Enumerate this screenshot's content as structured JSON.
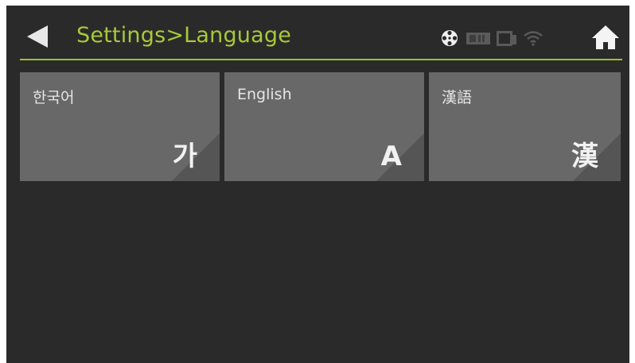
{
  "header": {
    "title": "Settings>Language",
    "back_icon": "back-arrow-icon",
    "home_icon": "home-icon",
    "status_icons": [
      "disc-icon",
      "card-slot-icon",
      "device-icon",
      "wifi-icon"
    ]
  },
  "languages": [
    {
      "label": "한국어",
      "glyph": "가"
    },
    {
      "label": "English",
      "glyph": "A"
    },
    {
      "label": "漢語",
      "glyph": "漢"
    }
  ],
  "colors": {
    "screen_bg": "#2a2a2a",
    "accent": "#a8c83a",
    "tile_bg": "#686868",
    "tile_text": "#e6e6e6",
    "icon_white": "#ffffff",
    "icon_dim": "#5a5a5a"
  }
}
